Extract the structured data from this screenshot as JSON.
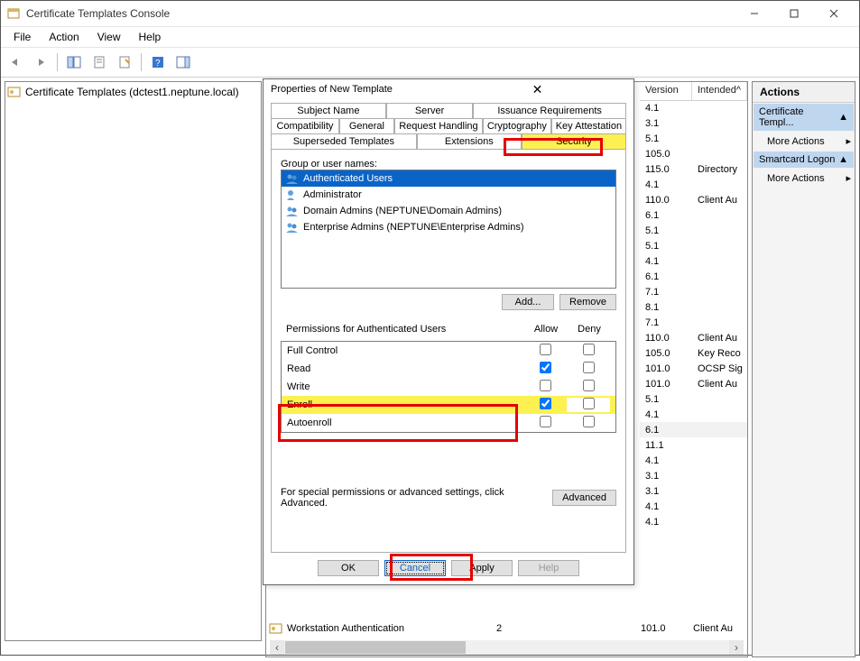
{
  "window": {
    "title": "Certificate Templates Console",
    "menus": [
      "File",
      "Action",
      "View",
      "Help"
    ]
  },
  "tree": {
    "root": "Certificate Templates (dctest1.neptune.local)"
  },
  "grid": {
    "columns": {
      "version": "Version",
      "intended": "Intended"
    },
    "rows": [
      {
        "v": "4.1",
        "i": ""
      },
      {
        "v": "3.1",
        "i": ""
      },
      {
        "v": "5.1",
        "i": ""
      },
      {
        "v": "105.0",
        "i": ""
      },
      {
        "v": "115.0",
        "i": "Directory"
      },
      {
        "v": "4.1",
        "i": ""
      },
      {
        "v": "110.0",
        "i": "Client Au"
      },
      {
        "v": "6.1",
        "i": ""
      },
      {
        "v": "5.1",
        "i": ""
      },
      {
        "v": "5.1",
        "i": ""
      },
      {
        "v": "4.1",
        "i": ""
      },
      {
        "v": "6.1",
        "i": ""
      },
      {
        "v": "7.1",
        "i": ""
      },
      {
        "v": "8.1",
        "i": ""
      },
      {
        "v": "7.1",
        "i": ""
      },
      {
        "v": "110.0",
        "i": "Client Au"
      },
      {
        "v": "105.0",
        "i": "Key Reco"
      },
      {
        "v": "101.0",
        "i": "OCSP Sig"
      },
      {
        "v": "101.0",
        "i": "Client Au"
      },
      {
        "v": "5.1",
        "i": ""
      },
      {
        "v": "4.1",
        "i": ""
      },
      {
        "v": "6.1",
        "i": ""
      },
      {
        "v": "11.1",
        "i": ""
      },
      {
        "v": "4.1",
        "i": ""
      },
      {
        "v": "3.1",
        "i": ""
      },
      {
        "v": "3.1",
        "i": ""
      },
      {
        "v": "4.1",
        "i": ""
      },
      {
        "v": "4.1",
        "i": ""
      }
    ],
    "workstation_row": {
      "name": "Workstation Authentication",
      "num": "2",
      "ver": "101.0",
      "int": "Client Au"
    }
  },
  "actions": {
    "header": "Actions",
    "section1": "Certificate Templ...",
    "section2": "Smartcard Logon",
    "more": "More Actions"
  },
  "dialog": {
    "title": "Properties of New Template",
    "tabs_row1": [
      "Subject Name",
      "Server",
      "Issuance Requirements"
    ],
    "tabs_row2": [
      "Compatibility",
      "General",
      "Request Handling",
      "Cryptography",
      "Key Attestation"
    ],
    "tabs_row3": [
      "Superseded Templates",
      "Extensions",
      "Security"
    ],
    "group_label": "Group or user names:",
    "principals": [
      "Authenticated Users",
      "Administrator",
      "Domain Admins (NEPTUNE\\Domain Admins)",
      "Enterprise Admins (NEPTUNE\\Enterprise Admins)"
    ],
    "add": "Add...",
    "remove": "Remove",
    "perm_for": "Permissions for Authenticated Users",
    "allow": "Allow",
    "deny": "Deny",
    "perms": [
      "Full Control",
      "Read",
      "Write",
      "Enroll",
      "Autoenroll"
    ],
    "advanced_text": "For special permissions or advanced settings, click Advanced.",
    "advanced": "Advanced",
    "ok": "OK",
    "cancel": "Cancel",
    "apply": "Apply",
    "help": "Help"
  }
}
